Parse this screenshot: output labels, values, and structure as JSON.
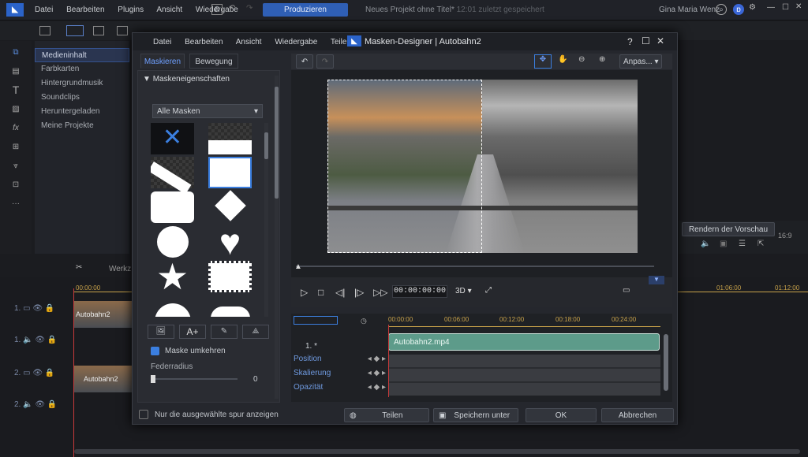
{
  "topbar": {
    "menus": [
      "Datei",
      "Bearbeiten",
      "Plugins",
      "Ansicht",
      "Wiedergabe"
    ],
    "produce": "Produzieren",
    "project": "Neues Projekt ohne Titel*",
    "saved": "12:01 zuletzt gespeichert",
    "user": "Gina Maria Wenz"
  },
  "media": {
    "items": [
      "Medieninhalt",
      "Farbkarten",
      "Hintergrundmusik",
      "Soundclips",
      "Heruntergeladen",
      "Meine Projekte"
    ]
  },
  "right": {
    "render": "Rendern der Vorschau",
    "ratio": "16:9"
  },
  "timeline": {
    "werkz": "Werkz",
    "ruler": [
      "00:00:00",
      "01:06:00",
      "01:12:00"
    ],
    "tracks": [
      "1.",
      "1.",
      "2.",
      "2.",
      "3."
    ],
    "clip1": "Autobahn2",
    "clip2": "Autobahn2"
  },
  "dialog": {
    "menus": [
      "Datei",
      "Bearbeiten",
      "Ansicht",
      "Wiedergabe",
      "Teilen"
    ],
    "title": "Masken-Designer  |  Autobahn2",
    "tabs": [
      "Maskieren",
      "Bewegung"
    ],
    "section": "Maskeneigenschaften",
    "dropdown": "Alle Masken",
    "invert": "Maske umkehren",
    "feather_label": "Federradius",
    "feather_value": "0",
    "zoom": "Anpas...",
    "timecode": "00:00:00:00",
    "mode": "3D",
    "ruler": [
      "00:00:00",
      "00:06:00",
      "00:12:00",
      "00:18:00",
      "00:24:00"
    ],
    "track": "1. *",
    "clip": "Autobahn2.mp4",
    "props": [
      "Position",
      "Skalierung",
      "Opazität"
    ],
    "show_only": "Nur die ausgewählte spur anzeigen",
    "buttons": {
      "share": "Teilen",
      "save": "Speichern unter",
      "ok": "OK",
      "cancel": "Abbrechen"
    }
  },
  "colors": {
    "accent": "#2f5fb5",
    "clip": "#5d9b8a"
  }
}
